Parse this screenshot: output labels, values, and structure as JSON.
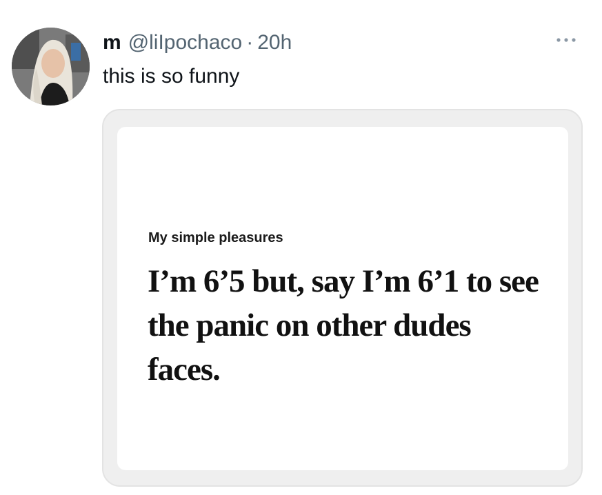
{
  "tweet": {
    "display_name": "m",
    "handle": "@liIpochaco",
    "separator": "·",
    "time": "20h",
    "text": "this is so funny",
    "more_icon": "more-horizontal-icon"
  },
  "media": {
    "label": "My simple pleasures",
    "quote": "I’m 6’5 but, say I’m 6’1 to see the panic on other dudes faces."
  },
  "colors": {
    "text_primary": "#0f1419",
    "text_secondary": "#536471",
    "media_border": "#e3e3e3",
    "media_background": "#efefef"
  }
}
